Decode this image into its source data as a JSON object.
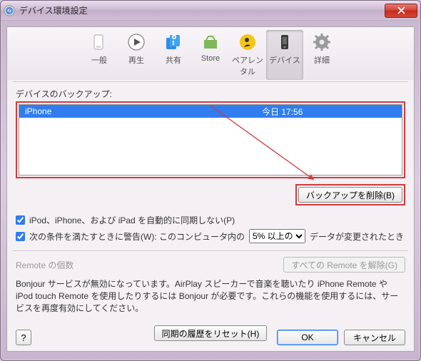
{
  "titlebar": {
    "title": "デバイス環境設定"
  },
  "toolbar": {
    "items": [
      {
        "label": "一般"
      },
      {
        "label": "再生"
      },
      {
        "label": "共有"
      },
      {
        "label": "Store"
      },
      {
        "label": "ペアレンタル"
      },
      {
        "label": "デバイス"
      },
      {
        "label": "詳細"
      }
    ],
    "active_index": 5
  },
  "backup": {
    "label": "デバイスのバックアップ:",
    "rows": [
      {
        "device": "iPhone",
        "time": "今日 17:56"
      }
    ],
    "delete_button": "バックアップを削除(B)"
  },
  "options": {
    "auto_sync": "iPod、iPhone、および iPad を自動的に同期しない(P)",
    "warn_label": "次の条件を満たすときに警告(W): このコンピュータ内の",
    "threshold_options": [
      "5% 以上の"
    ],
    "threshold_selected": "5% 以上の",
    "warn_tail": "データが変更されたとき"
  },
  "remote": {
    "label": "Remote の個数",
    "clear_button": "すべての Remote を解除(G)"
  },
  "bonjour_text": "Bonjour サービスが無効になっています。AirPlay スピーカーで音楽を聴いたり iPhone Remote や iPod touch Remote を使用したりするには Bonjour が必要です。これらの機能を使用するには、サービスを再度有効にしてください。",
  "reset_button": "同期の履歴をリセット(H)",
  "footer": {
    "help": "?",
    "ok": "OK",
    "cancel": "キャンセル"
  }
}
